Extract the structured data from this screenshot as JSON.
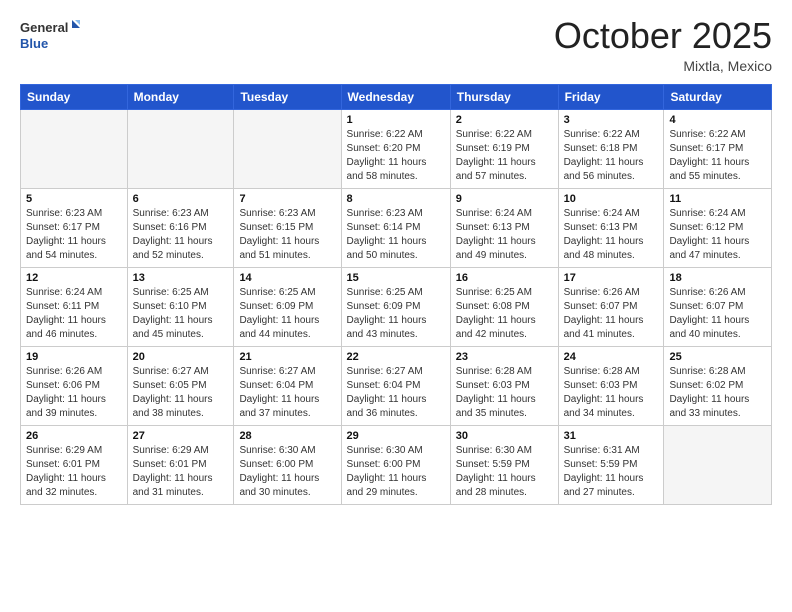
{
  "header": {
    "logo_general": "General",
    "logo_blue": "Blue",
    "month_title": "October 2025",
    "location": "Mixtla, Mexico"
  },
  "days_of_week": [
    "Sunday",
    "Monday",
    "Tuesday",
    "Wednesday",
    "Thursday",
    "Friday",
    "Saturday"
  ],
  "weeks": [
    [
      {
        "day": "",
        "sunrise": "",
        "sunset": "",
        "daylight": "",
        "empty": true
      },
      {
        "day": "",
        "sunrise": "",
        "sunset": "",
        "daylight": "",
        "empty": true
      },
      {
        "day": "",
        "sunrise": "",
        "sunset": "",
        "daylight": "",
        "empty": true
      },
      {
        "day": "1",
        "sunrise": "Sunrise: 6:22 AM",
        "sunset": "Sunset: 6:20 PM",
        "daylight": "Daylight: 11 hours and 58 minutes."
      },
      {
        "day": "2",
        "sunrise": "Sunrise: 6:22 AM",
        "sunset": "Sunset: 6:19 PM",
        "daylight": "Daylight: 11 hours and 57 minutes."
      },
      {
        "day": "3",
        "sunrise": "Sunrise: 6:22 AM",
        "sunset": "Sunset: 6:18 PM",
        "daylight": "Daylight: 11 hours and 56 minutes."
      },
      {
        "day": "4",
        "sunrise": "Sunrise: 6:22 AM",
        "sunset": "Sunset: 6:17 PM",
        "daylight": "Daylight: 11 hours and 55 minutes."
      }
    ],
    [
      {
        "day": "5",
        "sunrise": "Sunrise: 6:23 AM",
        "sunset": "Sunset: 6:17 PM",
        "daylight": "Daylight: 11 hours and 54 minutes."
      },
      {
        "day": "6",
        "sunrise": "Sunrise: 6:23 AM",
        "sunset": "Sunset: 6:16 PM",
        "daylight": "Daylight: 11 hours and 52 minutes."
      },
      {
        "day": "7",
        "sunrise": "Sunrise: 6:23 AM",
        "sunset": "Sunset: 6:15 PM",
        "daylight": "Daylight: 11 hours and 51 minutes."
      },
      {
        "day": "8",
        "sunrise": "Sunrise: 6:23 AM",
        "sunset": "Sunset: 6:14 PM",
        "daylight": "Daylight: 11 hours and 50 minutes."
      },
      {
        "day": "9",
        "sunrise": "Sunrise: 6:24 AM",
        "sunset": "Sunset: 6:13 PM",
        "daylight": "Daylight: 11 hours and 49 minutes."
      },
      {
        "day": "10",
        "sunrise": "Sunrise: 6:24 AM",
        "sunset": "Sunset: 6:13 PM",
        "daylight": "Daylight: 11 hours and 48 minutes."
      },
      {
        "day": "11",
        "sunrise": "Sunrise: 6:24 AM",
        "sunset": "Sunset: 6:12 PM",
        "daylight": "Daylight: 11 hours and 47 minutes."
      }
    ],
    [
      {
        "day": "12",
        "sunrise": "Sunrise: 6:24 AM",
        "sunset": "Sunset: 6:11 PM",
        "daylight": "Daylight: 11 hours and 46 minutes."
      },
      {
        "day": "13",
        "sunrise": "Sunrise: 6:25 AM",
        "sunset": "Sunset: 6:10 PM",
        "daylight": "Daylight: 11 hours and 45 minutes."
      },
      {
        "day": "14",
        "sunrise": "Sunrise: 6:25 AM",
        "sunset": "Sunset: 6:09 PM",
        "daylight": "Daylight: 11 hours and 44 minutes."
      },
      {
        "day": "15",
        "sunrise": "Sunrise: 6:25 AM",
        "sunset": "Sunset: 6:09 PM",
        "daylight": "Daylight: 11 hours and 43 minutes."
      },
      {
        "day": "16",
        "sunrise": "Sunrise: 6:25 AM",
        "sunset": "Sunset: 6:08 PM",
        "daylight": "Daylight: 11 hours and 42 minutes."
      },
      {
        "day": "17",
        "sunrise": "Sunrise: 6:26 AM",
        "sunset": "Sunset: 6:07 PM",
        "daylight": "Daylight: 11 hours and 41 minutes."
      },
      {
        "day": "18",
        "sunrise": "Sunrise: 6:26 AM",
        "sunset": "Sunset: 6:07 PM",
        "daylight": "Daylight: 11 hours and 40 minutes."
      }
    ],
    [
      {
        "day": "19",
        "sunrise": "Sunrise: 6:26 AM",
        "sunset": "Sunset: 6:06 PM",
        "daylight": "Daylight: 11 hours and 39 minutes."
      },
      {
        "day": "20",
        "sunrise": "Sunrise: 6:27 AM",
        "sunset": "Sunset: 6:05 PM",
        "daylight": "Daylight: 11 hours and 38 minutes."
      },
      {
        "day": "21",
        "sunrise": "Sunrise: 6:27 AM",
        "sunset": "Sunset: 6:04 PM",
        "daylight": "Daylight: 11 hours and 37 minutes."
      },
      {
        "day": "22",
        "sunrise": "Sunrise: 6:27 AM",
        "sunset": "Sunset: 6:04 PM",
        "daylight": "Daylight: 11 hours and 36 minutes."
      },
      {
        "day": "23",
        "sunrise": "Sunrise: 6:28 AM",
        "sunset": "Sunset: 6:03 PM",
        "daylight": "Daylight: 11 hours and 35 minutes."
      },
      {
        "day": "24",
        "sunrise": "Sunrise: 6:28 AM",
        "sunset": "Sunset: 6:03 PM",
        "daylight": "Daylight: 11 hours and 34 minutes."
      },
      {
        "day": "25",
        "sunrise": "Sunrise: 6:28 AM",
        "sunset": "Sunset: 6:02 PM",
        "daylight": "Daylight: 11 hours and 33 minutes."
      }
    ],
    [
      {
        "day": "26",
        "sunrise": "Sunrise: 6:29 AM",
        "sunset": "Sunset: 6:01 PM",
        "daylight": "Daylight: 11 hours and 32 minutes."
      },
      {
        "day": "27",
        "sunrise": "Sunrise: 6:29 AM",
        "sunset": "Sunset: 6:01 PM",
        "daylight": "Daylight: 11 hours and 31 minutes."
      },
      {
        "day": "28",
        "sunrise": "Sunrise: 6:30 AM",
        "sunset": "Sunset: 6:00 PM",
        "daylight": "Daylight: 11 hours and 30 minutes."
      },
      {
        "day": "29",
        "sunrise": "Sunrise: 6:30 AM",
        "sunset": "Sunset: 6:00 PM",
        "daylight": "Daylight: 11 hours and 29 minutes."
      },
      {
        "day": "30",
        "sunrise": "Sunrise: 6:30 AM",
        "sunset": "Sunset: 5:59 PM",
        "daylight": "Daylight: 11 hours and 28 minutes."
      },
      {
        "day": "31",
        "sunrise": "Sunrise: 6:31 AM",
        "sunset": "Sunset: 5:59 PM",
        "daylight": "Daylight: 11 hours and 27 minutes."
      },
      {
        "day": "",
        "sunrise": "",
        "sunset": "",
        "daylight": "",
        "empty": true
      }
    ]
  ]
}
